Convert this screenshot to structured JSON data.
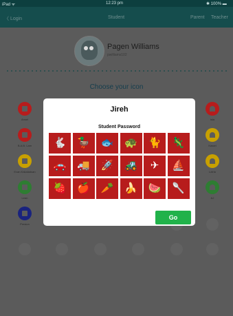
{
  "status_bar": {
    "carrier": "iPad ᯤ",
    "time": "12:23 pm",
    "battery": "✱ 100% ▬"
  },
  "nav": {
    "back": "〈 Login",
    "title": "Student",
    "right_1": "Parent",
    "right_2": "Teacher"
  },
  "profile": {
    "name": "Pagen Williams",
    "username": "pwilliams102"
  },
  "choose_label": "Choose your icon",
  "students": [
    {
      "label": "Ansel",
      "color": "#b71c1c",
      "shape": "square"
    },
    {
      "label": "Isla",
      "color": "#b71c1c",
      "shape": "heart"
    },
    {
      "label": "B.A.B. Lam",
      "color": "#b71c1c",
      "shape": "square"
    },
    {
      "label": "Kasari",
      "color": "#c8a000",
      "shape": "heart"
    },
    {
      "label": "Evan Kakaladsan",
      "color": "#c8a000",
      "shape": "square"
    },
    {
      "label": "Leiria",
      "color": "#c8a000",
      "shape": "heart"
    },
    {
      "label": "Lean",
      "color": "#2e7d32",
      "shape": "square"
    },
    {
      "label": "AJ",
      "color": "#2e7d32",
      "shape": "heart"
    },
    {
      "label": "Preston",
      "color": "#1a237e",
      "shape": "square"
    },
    {
      "label": "Kathleen",
      "color": "#1a237e",
      "shape": "square"
    },
    {
      "label": "William",
      "color": "#1a237e",
      "shape": "square"
    },
    {
      "label": "Alex",
      "color": "#1a237e",
      "shape": "square"
    }
  ],
  "modal": {
    "title": "Jireh",
    "subtitle": "Student Password",
    "icons": [
      {
        "name": "rabbit",
        "glyph": "🐇"
      },
      {
        "name": "duck",
        "glyph": "🦆"
      },
      {
        "name": "fish",
        "glyph": "🐟"
      },
      {
        "name": "turtle",
        "glyph": "🐢"
      },
      {
        "name": "cat",
        "glyph": "🐈"
      },
      {
        "name": "lizard",
        "glyph": "🦎"
      },
      {
        "name": "car",
        "glyph": "🚗"
      },
      {
        "name": "truck",
        "glyph": "🚚"
      },
      {
        "name": "rocket",
        "glyph": "🚀"
      },
      {
        "name": "tractor",
        "glyph": "🚜"
      },
      {
        "name": "airplane",
        "glyph": "✈"
      },
      {
        "name": "sailboat",
        "glyph": "⛵"
      },
      {
        "name": "strawberry",
        "glyph": "🍓"
      },
      {
        "name": "apple",
        "glyph": "🍎"
      },
      {
        "name": "carrot",
        "glyph": "🥕"
      },
      {
        "name": "banana",
        "glyph": "🍌"
      },
      {
        "name": "watermelon",
        "glyph": "🍉"
      },
      {
        "name": "spoon",
        "glyph": "🥄"
      }
    ],
    "go_label": "Go"
  }
}
